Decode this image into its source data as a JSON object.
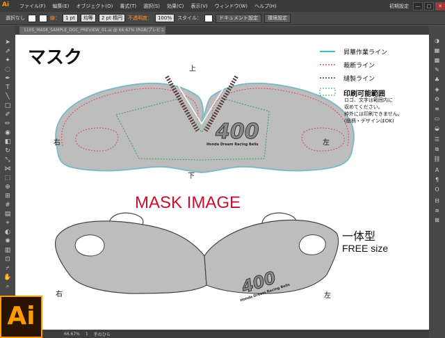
{
  "app": {
    "logo": "Ai",
    "menu": [
      "ファイル(F)",
      "編集(E)",
      "オブジェクト(O)",
      "書式(T)",
      "選択(S)",
      "効果(C)",
      "表示(V)",
      "ウィンドウ(W)",
      "ヘルプ(H)"
    ],
    "workspace": "初期設定",
    "window_buttons": [
      "—",
      "□",
      "✕"
    ]
  },
  "control_bar": {
    "selection": "選択なし",
    "stroke_label": "線：",
    "stroke_weight": "1 pt",
    "stroke_profile": "均等",
    "brush": "2 pt 楕円",
    "opacity_label": "不透明度：",
    "opacity": "100%",
    "style_label": "スタイル：",
    "doc_settings": "ドキュメント設定",
    "prefs": "環境設定"
  },
  "document": {
    "tab_title": "1105_MASK_SAMPLE_DOC_PREVIEW_01.ai @ 66.67% (RGB/プレビュー)"
  },
  "artwork": {
    "title": "マスク",
    "top_label": "上",
    "bottom_label": "下",
    "left_label": "右",
    "right_label": "左",
    "legend": [
      {
        "label": "昇華作業ライン",
        "color": "#3dbdc4",
        "style": "solid"
      },
      {
        "label": "裁断ライン",
        "color": "#e0455a",
        "style": "dotted"
      },
      {
        "label": "縫製ライン",
        "color": "#333333",
        "style": "dotted"
      },
      {
        "label": "印刷可能範囲",
        "color": "#2e9e5a",
        "style": "dashed"
      }
    ],
    "note": [
      "ロゴ、文字は範囲内に",
      "収めてください。",
      "枠外には印刷できません。",
      "(総柄・デザインはOK)"
    ],
    "logo_number": "400",
    "logo_text": "Honda Dream Racing Bells",
    "mask_image_title": "MASK IMAGE",
    "type_label": "一体型",
    "size_label": "FREE size",
    "preview_left_label": "右",
    "preview_right_label": "左"
  },
  "status": {
    "zoom": "66.67%",
    "page": "1",
    "tool": "手のひら"
  },
  "badge": "Ai"
}
